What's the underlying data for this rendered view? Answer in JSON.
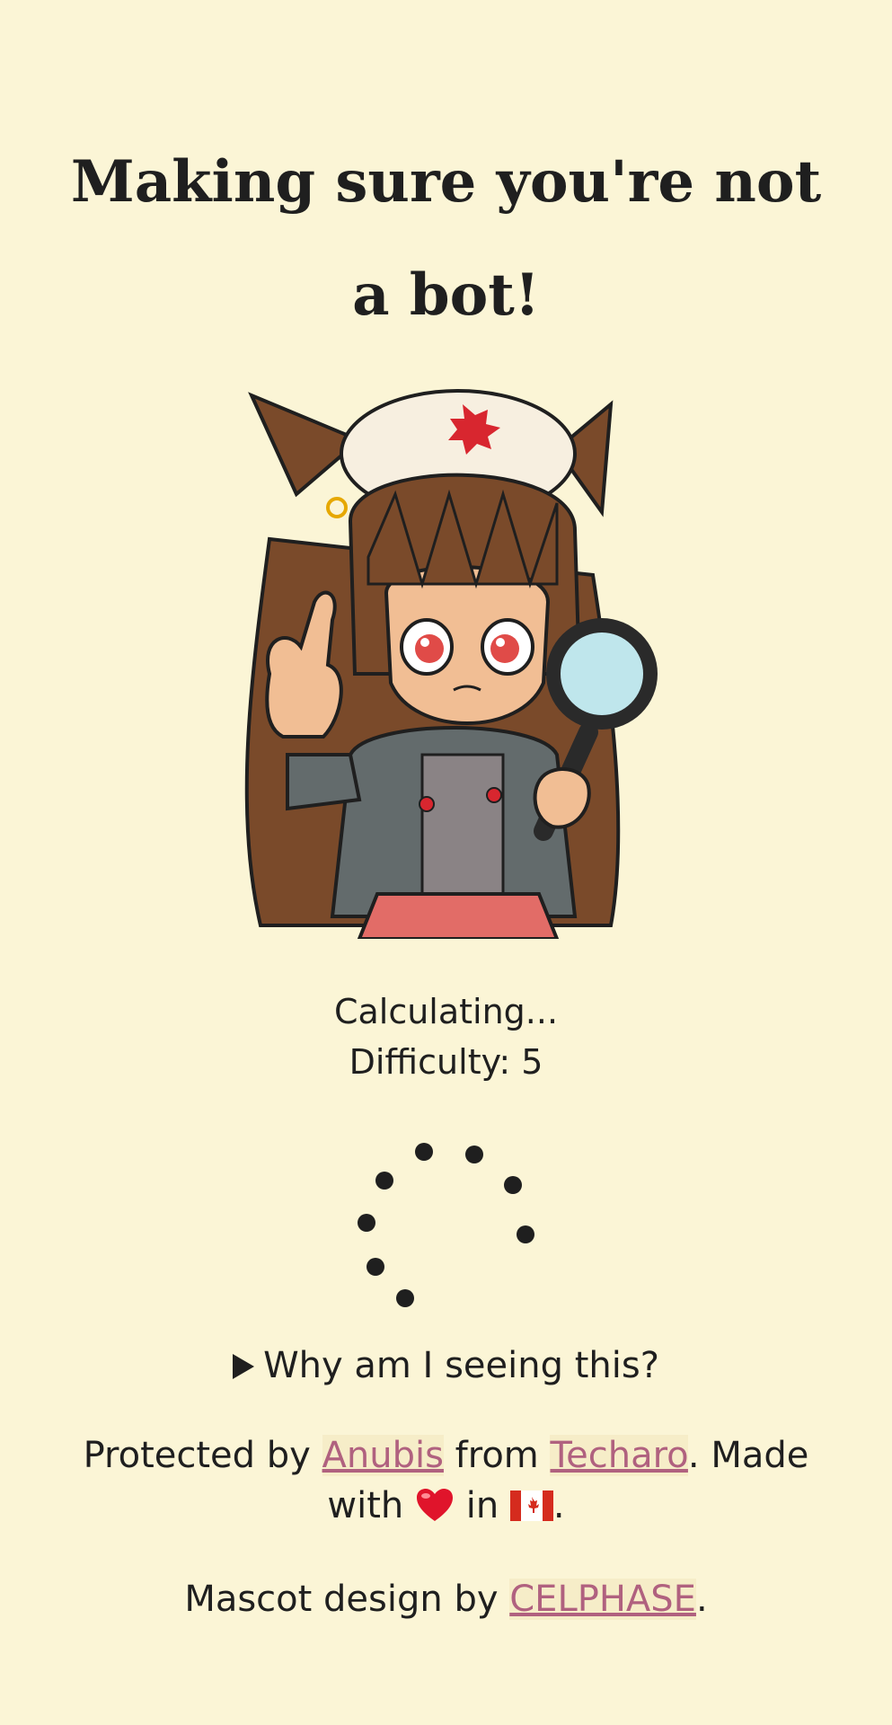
{
  "page": {
    "title": "Making sure you're not a bot!"
  },
  "status": {
    "line1": "Calculating...",
    "difficulty_label": "Difficulty: 5"
  },
  "details": {
    "summary": "Why am I seeing this?"
  },
  "credits": {
    "protected_by": "Protected by",
    "anubis_link": "Anubis",
    "from": "from",
    "techaro_link": "Techaro",
    "made_with": ". Made with",
    "in": "in",
    "period": "."
  },
  "mascot_credit": {
    "prefix": "Mascot design by",
    "celphase_link": "CELPHASE",
    "suffix": "."
  },
  "colors": {
    "background": "#fbf5d6",
    "link": "#b0617f",
    "text": "#1f1f1f"
  },
  "icons": {
    "heart": "red-heart-icon",
    "flag": "canada-flag-icon"
  }
}
